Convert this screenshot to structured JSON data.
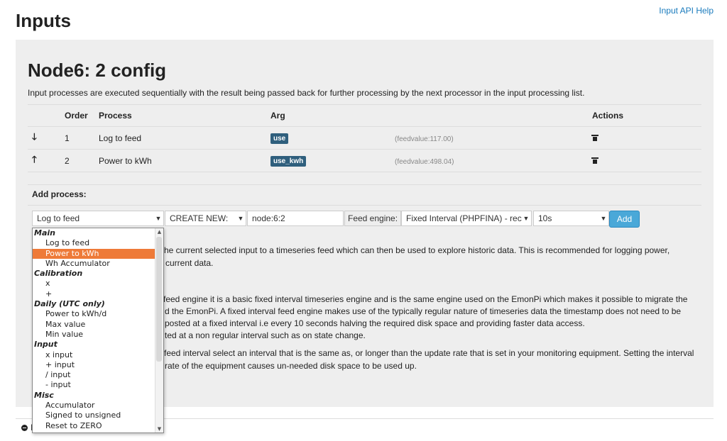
{
  "header": {
    "title": "Inputs",
    "help_link": "Input API Help"
  },
  "node": {
    "name": "Node6:",
    "id": "2",
    "suffix": "config"
  },
  "intro": "Input processes are executed sequentially with the result being passed back for further processing by the next processor in the input processing list.",
  "table": {
    "columns": [
      "Order",
      "Process",
      "Arg",
      "Actions"
    ],
    "rows": [
      {
        "arrow": "🡓",
        "order": "1",
        "process": "Log to feed",
        "arg": "use",
        "feedvalue": "(feedvalue:117.00)"
      },
      {
        "arrow": "🡑",
        "order": "2",
        "process": "Power to kWh",
        "arg": "use_kwh",
        "feedvalue": "(feedvalue:498.04)"
      }
    ]
  },
  "add_process": {
    "label": "Add process:",
    "process_select": "Log to feed",
    "create_select": "CREATE NEW:",
    "feed_name": "node:6:2",
    "engine_label": "Feed engine:",
    "engine_select": "Fixed Interval (PHPFINA) - rec",
    "interval_select": "10s",
    "add_button": "Add"
  },
  "description_lines": [
    "he current selected input to a timeseries feed which can then be used to explore historic data. This is recommended for logging power,",
    "current data.",
    "feed engine it is a basic fixed interval timeseries engine and is the same engine used on the EmonPi which makes it possible to migrate the",
    "d the EmonPi. A fixed interval feed engine makes use of the typically regular nature of timeseries data the timestamp does not need to be",
    "posted at a fixed interval i.e every 10 seconds halving the required disk space and providing faster data access.",
    "ted at a non regular interval such as on state change.",
    "feed interval select an interval that is the same as, or longer than the update rate that is set in your monitoring equipment. Setting the interval",
    "rate of the equipment causes un-needed disk space to be used up."
  ],
  "dropdown": {
    "items": [
      {
        "type": "group",
        "label": "Main"
      },
      {
        "type": "option",
        "label": "Log to feed"
      },
      {
        "type": "option",
        "label": "Power to kWh",
        "selected": true
      },
      {
        "type": "option",
        "label": "Wh Accumulator"
      },
      {
        "type": "group",
        "label": "Calibration"
      },
      {
        "type": "option",
        "label": "x"
      },
      {
        "type": "option",
        "label": "+"
      },
      {
        "type": "group",
        "label": "Daily (UTC only)"
      },
      {
        "type": "option",
        "label": "Power to kWh/d"
      },
      {
        "type": "option",
        "label": "Max value"
      },
      {
        "type": "option",
        "label": "Min value"
      },
      {
        "type": "group",
        "label": "Input"
      },
      {
        "type": "option",
        "label": "x input"
      },
      {
        "type": "option",
        "label": "+ input"
      },
      {
        "type": "option",
        "label": "/ input"
      },
      {
        "type": "option",
        "label": "- input"
      },
      {
        "type": "group",
        "label": "Misc"
      },
      {
        "type": "option",
        "label": "Accumulator"
      },
      {
        "type": "option",
        "label": "Signed to unsigned"
      },
      {
        "type": "option",
        "label": "Reset to ZERO"
      }
    ]
  },
  "footer": {
    "collapse_text": "I"
  },
  "colors": {
    "accent": "#4aa8d8",
    "badge": "#2f5f7d",
    "selected_option": "#ee7a38",
    "link": "#1a7bbd"
  }
}
